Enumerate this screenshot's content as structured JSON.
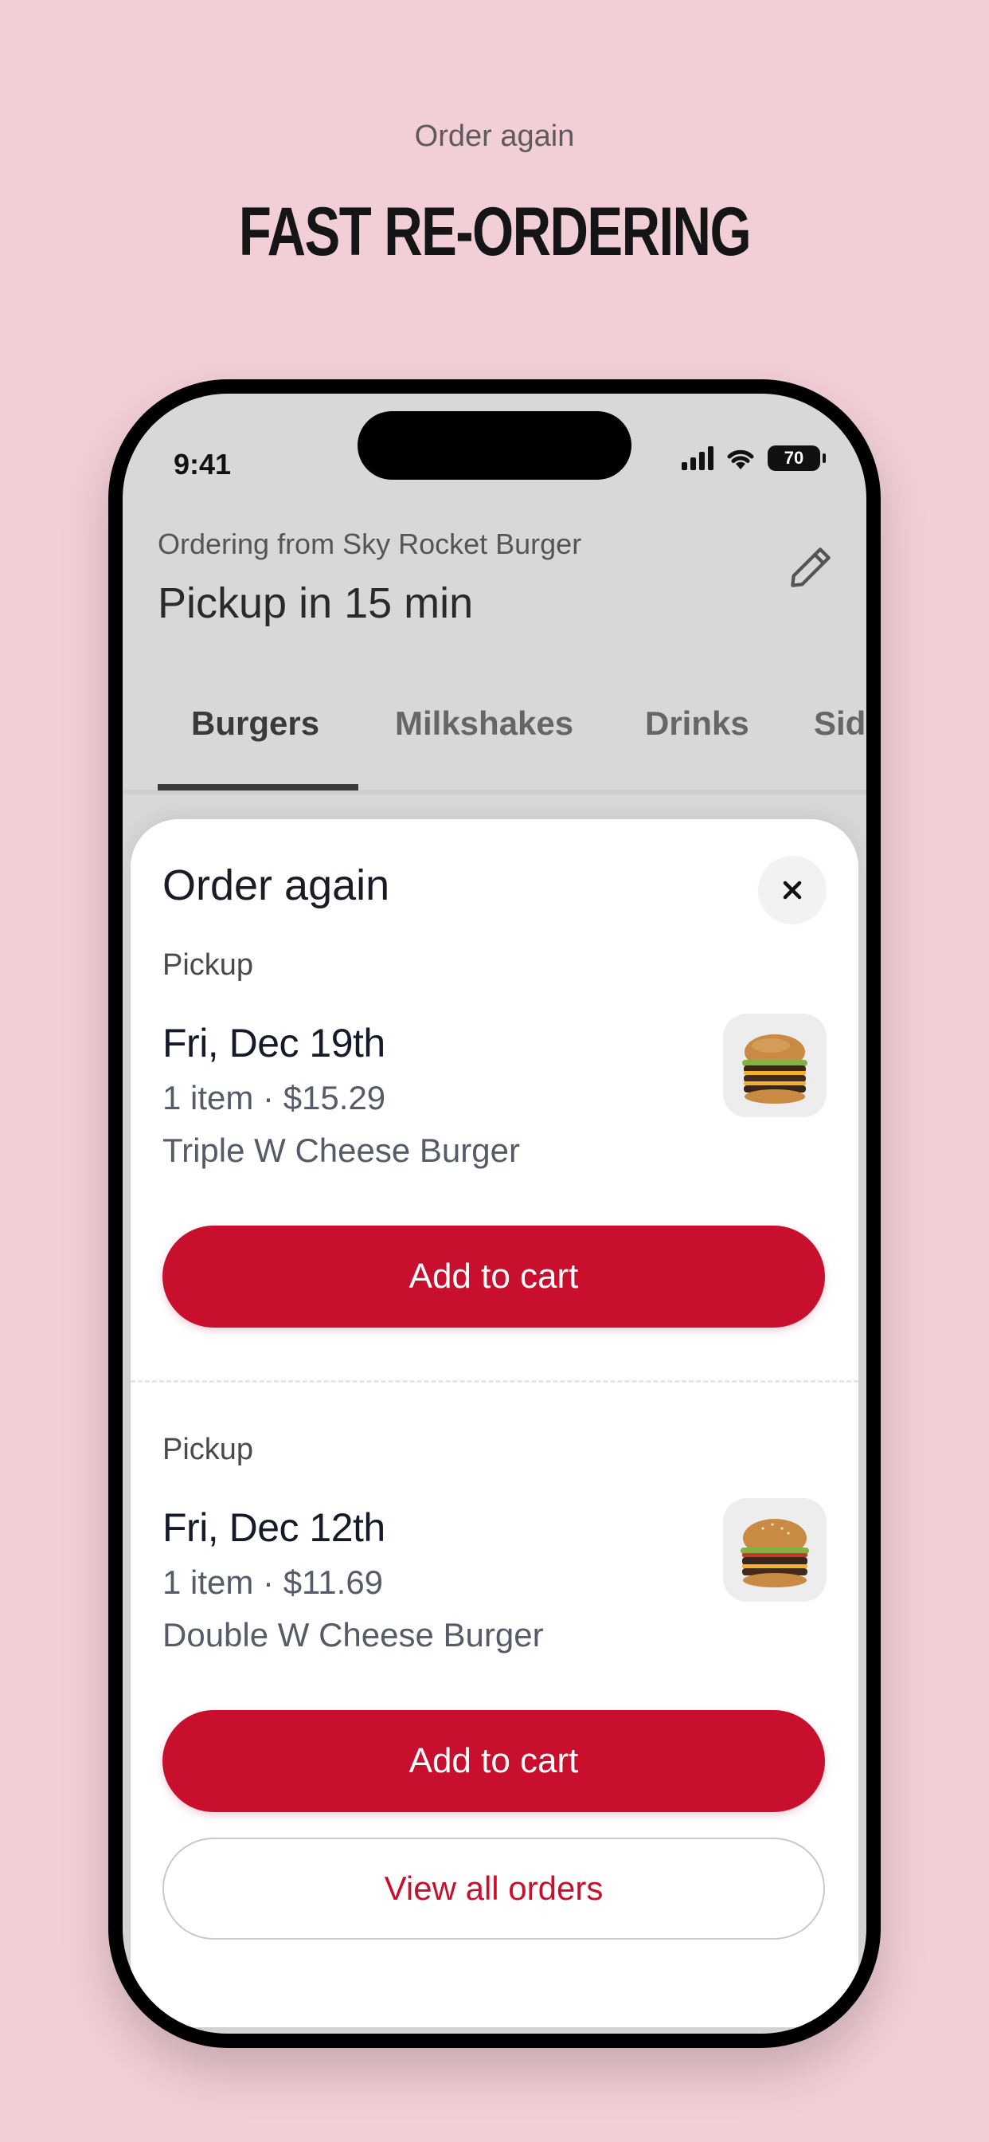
{
  "promo": {
    "subtitle": "Order again",
    "title": "FAST RE-ORDERING"
  },
  "status_bar": {
    "time": "9:41",
    "battery": "70"
  },
  "header": {
    "ordering_from": "Ordering from Sky Rocket Burger",
    "pickup": "Pickup in 15 min",
    "edit_icon": "pencil-icon"
  },
  "tabs": [
    {
      "label": "Burgers",
      "active": true
    },
    {
      "label": "Milkshakes",
      "active": false
    },
    {
      "label": "Drinks",
      "active": false
    },
    {
      "label": "Sides",
      "active": false
    }
  ],
  "sheet": {
    "title": "Order again",
    "close_icon": "close-icon",
    "orders": [
      {
        "type": "Pickup",
        "date": "Fri, Dec 19th",
        "meta": "1 item · $15.29",
        "item": "Triple W Cheese Burger",
        "button": "Add to cart",
        "image": "triple-burger-image"
      },
      {
        "type": "Pickup",
        "date": "Fri, Dec 12th",
        "meta": "1 item · $11.69",
        "item": "Double W Cheese Burger",
        "button": "Add to cart",
        "image": "double-burger-image"
      }
    ],
    "view_all": "View all orders"
  },
  "colors": {
    "background": "#f2cfd6",
    "brand_red": "#c8102e"
  }
}
